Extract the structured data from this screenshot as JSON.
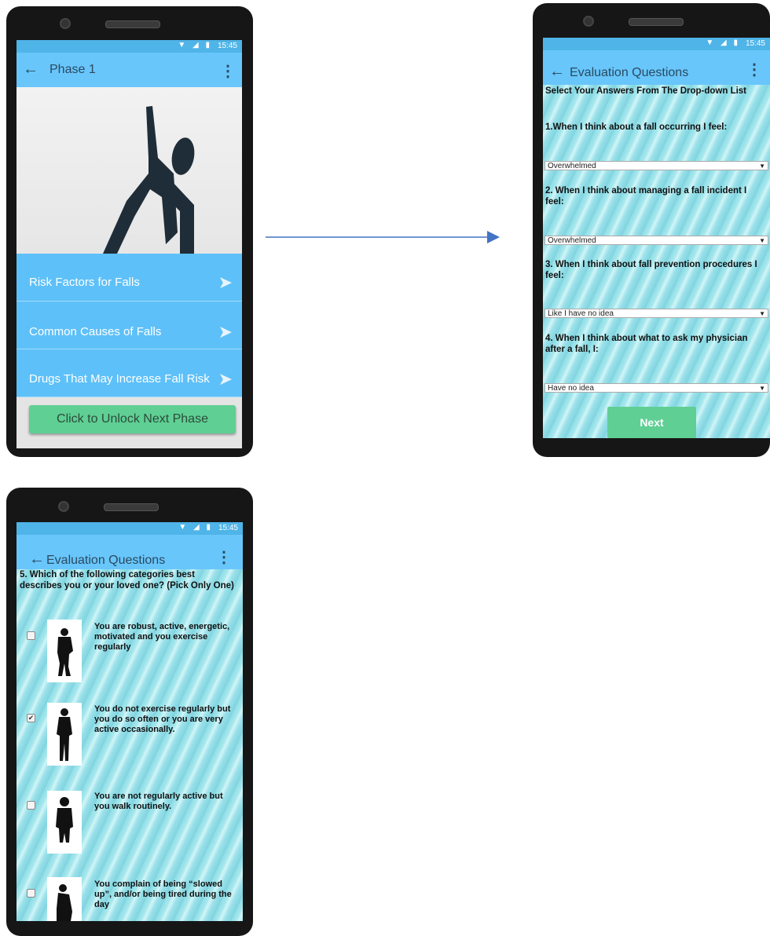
{
  "status": {
    "time": "15:45",
    "icons": "▼ ◢ ▮"
  },
  "screen1": {
    "title": "Phase 1",
    "menu_items": [
      "Risk Factors for Falls",
      "Common Causes of Falls",
      "Drugs That May Increase Fall Risk"
    ],
    "unlock_label": "Click to Unlock Next Phase",
    "go_glyph": "➤"
  },
  "screen2": {
    "title": "Evaluation Questions",
    "instruction": "Select Your Answers From The Drop-down List",
    "questions": [
      {
        "text": "1.When I think about a fall occurring I feel:",
        "answer": "Overwhelmed"
      },
      {
        "text": "2. When I think about managing a fall incident I feel:",
        "answer": "Overwhelmed"
      },
      {
        "text": "3. When I think about fall prevention procedures I feel:",
        "answer": "Like I have no idea"
      },
      {
        "text": "4. When I think about what to ask my physician after a fall, I:",
        "answer": "Have no idea"
      }
    ],
    "next_label": "Next"
  },
  "screen3": {
    "title": "Evaluation Questions",
    "question": "5. Which of the following categories best describes you or your loved one? (Pick Only One)",
    "options": [
      {
        "text": "You are robust, active, energetic, motivated and you exercise regularly",
        "checked": false
      },
      {
        "text": "You do not exercise regularly but you do so often or you are very active occasionally.",
        "checked": true
      },
      {
        "text": "You are not regularly active but you walk routinely.",
        "checked": false
      },
      {
        "text": "You complain of being “slowed up”, and/or being tired during the day",
        "checked": false
      }
    ]
  },
  "icons": {
    "back": "←",
    "menu": "⋮",
    "check": "✔",
    "dropdown": "▼"
  },
  "colors": {
    "appbar": "#68c6fb",
    "statusbar": "#4fb4e8",
    "menu_item": "#5ec0f8",
    "button_green": "#5fcf94",
    "arrow_blue": "#4472c4",
    "figure": "#1f2d38"
  }
}
